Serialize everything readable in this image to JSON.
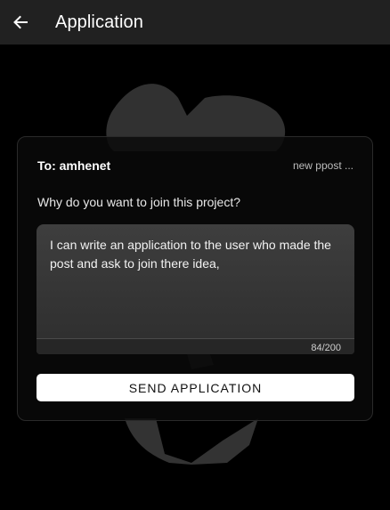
{
  "header": {
    "title": "Application",
    "back_icon": "arrow-left-icon"
  },
  "card": {
    "to_label": "To: amhenet",
    "post_name": "new ppost ...",
    "question": "Why do you want to join this project?",
    "message": {
      "value": "I can write an application to the user who made the post and ask to join there idea,",
      "counter": "84/200"
    },
    "send_label": "SEND APPLICATION"
  },
  "colors": {
    "background": "#000000",
    "topbar": "#212121",
    "button": "#ffffff",
    "field": "#3a3a3a"
  }
}
